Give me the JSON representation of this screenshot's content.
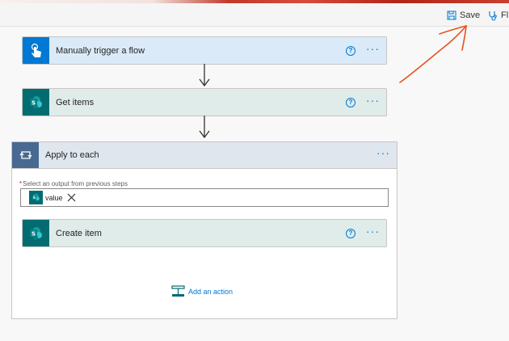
{
  "toolbar": {
    "save_label": "Save",
    "flow_checker_label": "Fl"
  },
  "icons": {
    "save": "save-icon",
    "flow_checker": "stethoscope-icon",
    "trigger": "hand-touch-icon",
    "sharepoint": "sharepoint-icon",
    "loop": "loop-icon",
    "help": "help-circle-icon",
    "more": "more-options-icon",
    "add_action": "add-action-icon",
    "remove": "close-icon"
  },
  "colors": {
    "accent": "#0078d4",
    "sharepoint": "#036c70",
    "loop": "#486991",
    "annotation": "#e8501d"
  },
  "steps": {
    "trigger": {
      "title": "Manually trigger a flow",
      "help": "?",
      "more": "···"
    },
    "get_items": {
      "title": "Get items",
      "help": "?",
      "more": "···"
    },
    "apply_to_each": {
      "title": "Apply to each",
      "more": "···",
      "field_required_mark": "*",
      "field_label": "Select an output from previous steps",
      "token_label": "value",
      "inner": {
        "create_item": {
          "title": "Create item",
          "help": "?",
          "more": "···"
        }
      },
      "add_action_label": "Add an action"
    }
  }
}
